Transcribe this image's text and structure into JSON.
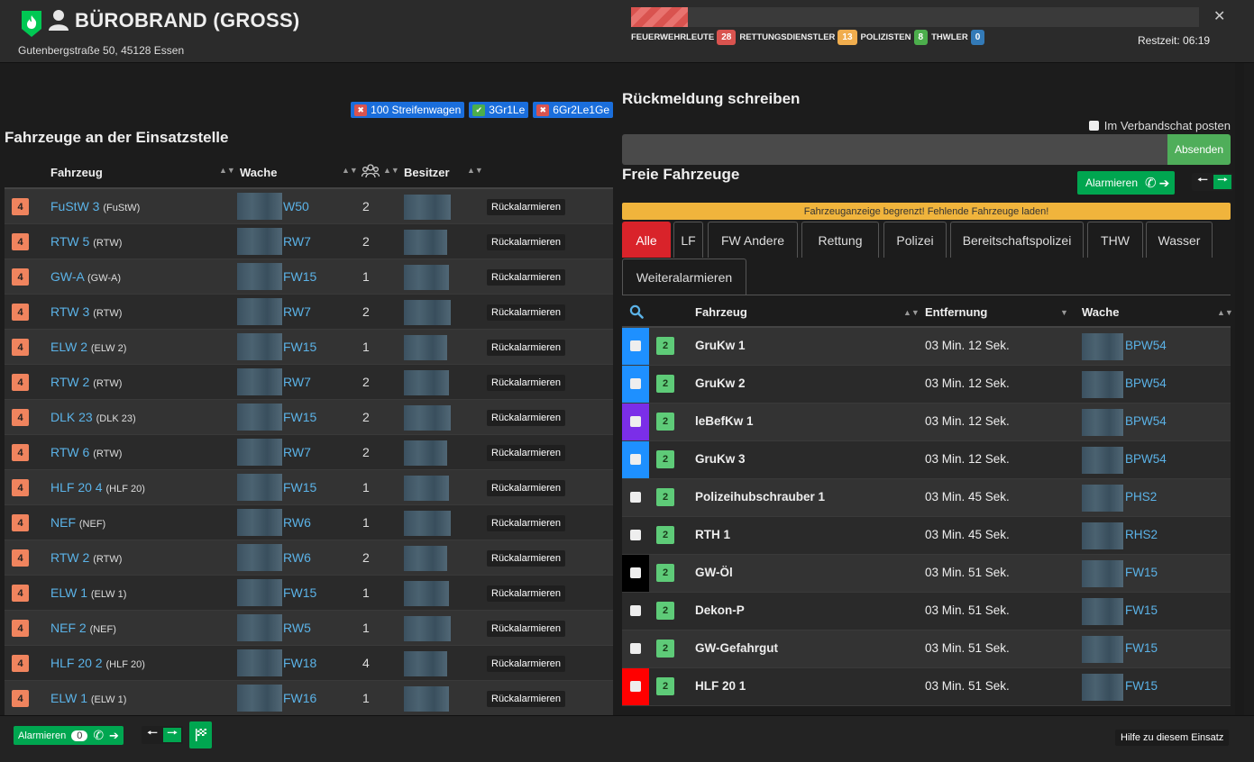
{
  "header": {
    "title": "BÜROBRAND (GROSS)",
    "address": "Gutenbergstraße 50, 45128 Essen",
    "progress_fraction": 0.1,
    "progress_color": "#d9534f",
    "personnel": [
      {
        "label": "FEUERWEHRLEUTE",
        "count": "28",
        "color": "#d9534f"
      },
      {
        "label": "RETTUNGSDIENSTLER",
        "count": "13",
        "color": "#f0ad4e"
      },
      {
        "label": "POLIZISTEN",
        "count": "8",
        "color": "#4cae4c"
      },
      {
        "label": "THWLER",
        "count": "0",
        "color": "#337ab7"
      }
    ],
    "restzeit": "Restzeit: 06:19",
    "close_icon": "close-icon"
  },
  "missing_tags": [
    {
      "label": "100 Streifenwagen",
      "ok": false
    },
    {
      "label": "3Gr1Le",
      "ok": true
    },
    {
      "label": "6Gr2Le1Ge",
      "ok": false
    }
  ],
  "vehicles_on_site": {
    "title": "Fahrzeuge an der Einsatzstelle",
    "columns": {
      "vehicle": "Fahrzeug",
      "station": "Wache",
      "crew_icon": "people-icon",
      "owner": "Besitzer"
    },
    "back_label": "Rückalarmieren",
    "rows": [
      {
        "status": "4",
        "name": "FuStW 3",
        "type": "(FuStW)",
        "station": "W50",
        "crew": "2"
      },
      {
        "status": "4",
        "name": "RTW 5",
        "type": "(RTW)",
        "station": "RW7",
        "crew": "2"
      },
      {
        "status": "4",
        "name": "GW-A",
        "type": "(GW-A)",
        "station": "FW15",
        "crew": "1"
      },
      {
        "status": "4",
        "name": "RTW 3",
        "type": "(RTW)",
        "station": "RW7",
        "crew": "2"
      },
      {
        "status": "4",
        "name": "ELW 2",
        "type": "(ELW 2)",
        "station": "FW15",
        "crew": "1"
      },
      {
        "status": "4",
        "name": "RTW 2",
        "type": "(RTW)",
        "station": "RW7",
        "crew": "2"
      },
      {
        "status": "4",
        "name": "DLK 23",
        "type": "(DLK 23)",
        "station": "FW15",
        "crew": "2"
      },
      {
        "status": "4",
        "name": "RTW 6",
        "type": "(RTW)",
        "station": "RW7",
        "crew": "2"
      },
      {
        "status": "4",
        "name": "HLF 20 4",
        "type": "(HLF 20)",
        "station": "FW15",
        "crew": "1"
      },
      {
        "status": "4",
        "name": "NEF",
        "type": "(NEF)",
        "station": "RW6",
        "crew": "1"
      },
      {
        "status": "4",
        "name": "RTW 2",
        "type": "(RTW)",
        "station": "RW6",
        "crew": "2"
      },
      {
        "status": "4",
        "name": "ELW 1",
        "type": "(ELW 1)",
        "station": "FW15",
        "crew": "1"
      },
      {
        "status": "4",
        "name": "NEF 2",
        "type": "(NEF)",
        "station": "RW5",
        "crew": "1"
      },
      {
        "status": "4",
        "name": "HLF 20 2",
        "type": "(HLF 20)",
        "station": "FW18",
        "crew": "4"
      },
      {
        "status": "4",
        "name": "ELW 1",
        "type": "(ELW 1)",
        "station": "FW16",
        "crew": "1"
      }
    ]
  },
  "feedback": {
    "title": "Rückmeldung schreiben",
    "alliance_label": "Im Verbandschat posten",
    "input_value": "",
    "send_label": "Absenden"
  },
  "free_vehicles": {
    "title": "Freie Fahrzeuge",
    "alarm_label": "Alarmieren",
    "warning": "Fahrzeuganzeige begrenzt! Fehlende Fahrzeuge laden!",
    "tabs": [
      "Alle",
      "LF",
      "FW Andere",
      "Rettung",
      "Polizei",
      "Bereitschaftspolizei",
      "THW",
      "Wasser",
      "Weiteralarmieren"
    ],
    "active_tab": "Alle",
    "columns": {
      "search_icon": "search-icon",
      "vehicle": "Fahrzeug",
      "distance": "Entfernung",
      "station": "Wache"
    },
    "rows": [
      {
        "status": "2",
        "name": "GruKw 1",
        "distance": "03 Min. 12 Sek.",
        "station": "BPW54",
        "color": "#1e90ff"
      },
      {
        "status": "2",
        "name": "GruKw 2",
        "distance": "03 Min. 12 Sek.",
        "station": "BPW54",
        "color": "#1e90ff"
      },
      {
        "status": "2",
        "name": "leBefKw 1",
        "distance": "03 Min. 12 Sek.",
        "station": "BPW54",
        "color": "#7b2ee8"
      },
      {
        "status": "2",
        "name": "GruKw 3",
        "distance": "03 Min. 12 Sek.",
        "station": "BPW54",
        "color": "#1e90ff"
      },
      {
        "status": "2",
        "name": "Polizeihubschrauber 1",
        "distance": "03 Min. 45 Sek.",
        "station": "PHS2",
        "color": ""
      },
      {
        "status": "2",
        "name": "RTH 1",
        "distance": "03 Min. 45 Sek.",
        "station": "RHS2",
        "color": ""
      },
      {
        "status": "2",
        "name": "GW-Öl",
        "distance": "03 Min. 51 Sek.",
        "station": "FW15",
        "color": "#000000"
      },
      {
        "status": "2",
        "name": "Dekon-P",
        "distance": "03 Min. 51 Sek.",
        "station": "FW15",
        "color": ""
      },
      {
        "status": "2",
        "name": "GW-Gefahrgut",
        "distance": "03 Min. 51 Sek.",
        "station": "FW15",
        "color": ""
      },
      {
        "status": "2",
        "name": "HLF 20 1",
        "distance": "03 Min. 51 Sek.",
        "station": "FW15",
        "color": "#ff0000"
      }
    ]
  },
  "footer": {
    "alarm_label": "Alarmieren",
    "alarm_count": "0",
    "help_label": "Hilfe zu diesem Einsatz"
  },
  "colors": {
    "accent_green": "#00a650",
    "link_blue": "#5bb3e8",
    "status4": "#f0845e",
    "status2": "#5ecb78",
    "active_tab": "#d9232a",
    "warning": "#f0b43c"
  }
}
